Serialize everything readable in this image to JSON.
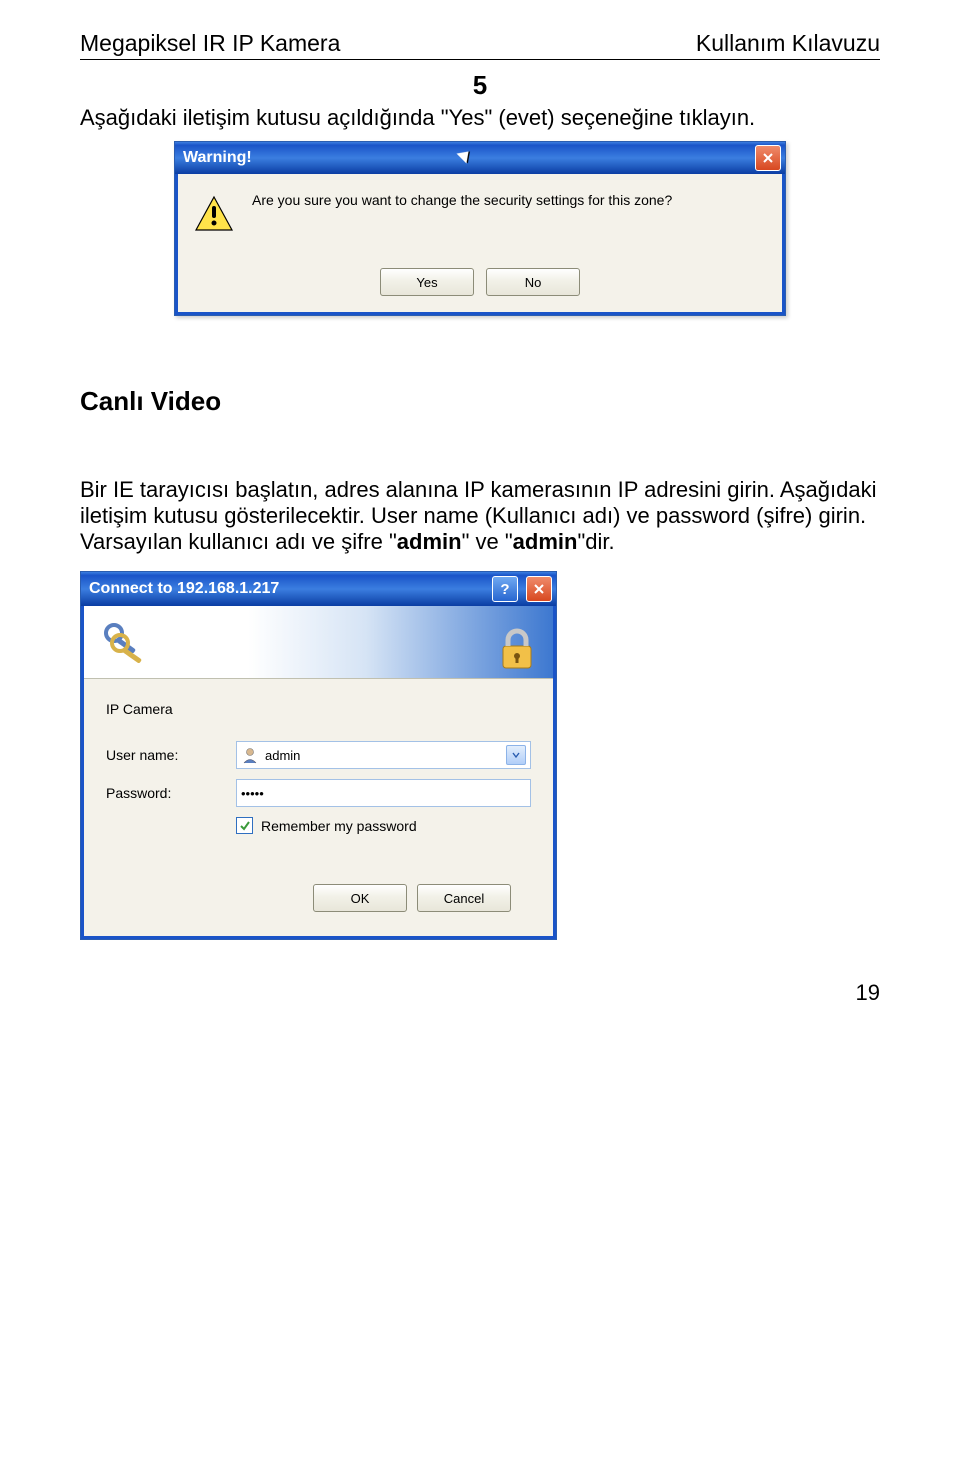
{
  "header": {
    "left": "Megapiksel IR IP  Kamera",
    "right": "Kullanım Kılavuzu"
  },
  "step_number": "5",
  "intro_text": "Aşağıdaki iletişim kutusu açıldığında \"Yes\" (evet) seçeneğine tıklayın.",
  "warning_dialog": {
    "title": "Warning!",
    "message": "Are you sure you want to change the security settings for this zone?",
    "yes": "Yes",
    "no": "No"
  },
  "section_title": "Canlı Video",
  "body_text": "Bir IE tarayıcısı başlatın, adres alanına IP kamerasının IP adresini girin. Aşağıdaki iletişim kutusu gösterilecektir. User name (Kullanıcı adı) ve password (şifre) girin. Varsayılan kullanıcı adı ve şifre \"admin\" ve \"admin\"dir.",
  "connect_dialog": {
    "title": "Connect to 192.168.1.217",
    "realm": "IP Camera",
    "user_label": "User name:",
    "user_value": "admin",
    "password_label": "Password:",
    "password_value": "•••••",
    "remember": "Remember my password",
    "ok": "OK",
    "cancel": "Cancel"
  },
  "page_number": "19"
}
